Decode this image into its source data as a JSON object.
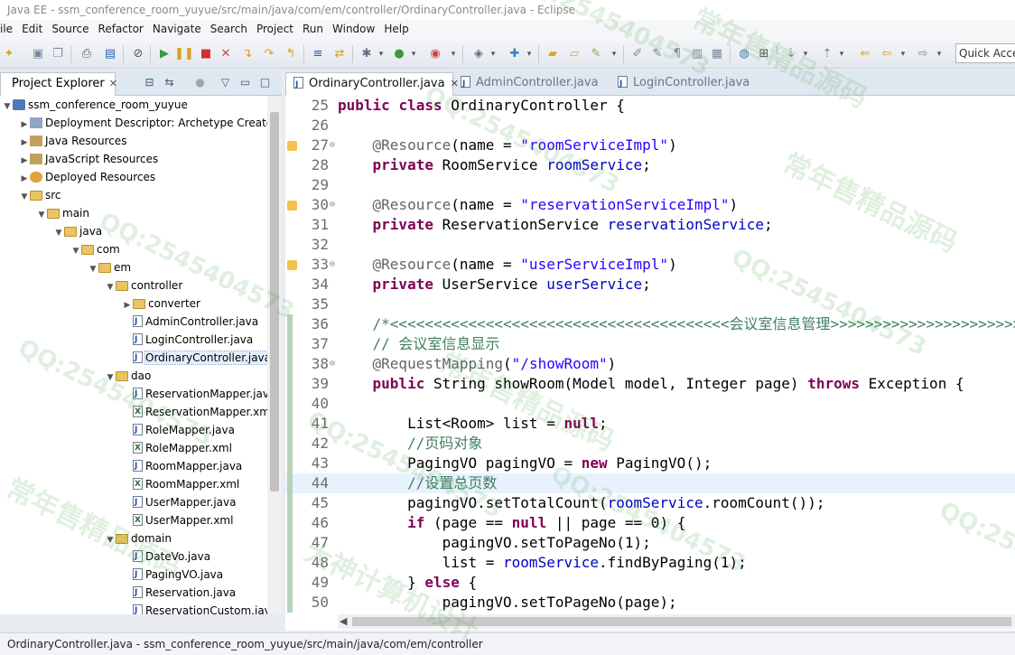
{
  "window_title": "Java EE - ssm_conference_room_yuyue/src/main/java/com/em/controller/OrdinaryController.java - Eclipse",
  "menu": [
    "ile",
    "Edit",
    "Source",
    "Refactor",
    "Navigate",
    "Search",
    "Project",
    "Run",
    "Window",
    "Help"
  ],
  "quick_access_placeholder": "Quick Access",
  "explorer": {
    "tab_label": "Project Explorer",
    "tree": [
      {
        "label": "ssm_conference_room_yuyue",
        "icon": "project-icon",
        "depth": 0,
        "expanded": true
      },
      {
        "label": "Deployment Descriptor: Archetype Created",
        "icon": "deployment-descriptor-icon",
        "depth": 1,
        "expanded": false
      },
      {
        "label": "Java Resources",
        "icon": "java-resources-icon",
        "depth": 1,
        "expanded": false
      },
      {
        "label": "JavaScript Resources",
        "icon": "javascript-resources-icon",
        "depth": 1,
        "expanded": false
      },
      {
        "label": "Deployed Resources",
        "icon": "deployed-resources-icon",
        "depth": 1,
        "expanded": false
      },
      {
        "label": "src",
        "icon": "folder-icon",
        "depth": 1,
        "expanded": true
      },
      {
        "label": "main",
        "icon": "folder-icon",
        "depth": 2,
        "expanded": true
      },
      {
        "label": "java",
        "icon": "folder-icon",
        "depth": 3,
        "expanded": true
      },
      {
        "label": "com",
        "icon": "folder-icon",
        "depth": 4,
        "expanded": true
      },
      {
        "label": "em",
        "icon": "folder-icon",
        "depth": 5,
        "expanded": true
      },
      {
        "label": "controller",
        "icon": "folder-icon",
        "depth": 6,
        "expanded": true
      },
      {
        "label": "converter",
        "icon": "folder-icon",
        "depth": 7,
        "expanded": false
      },
      {
        "label": "AdminController.java",
        "icon": "java-file-icon",
        "depth": 7
      },
      {
        "label": "LoginController.java",
        "icon": "java-file-icon",
        "depth": 7
      },
      {
        "label": "OrdinaryController.java",
        "icon": "java-file-icon",
        "depth": 7,
        "selected": true
      },
      {
        "label": "dao",
        "icon": "folder-icon",
        "depth": 6,
        "expanded": true
      },
      {
        "label": "ReservationMapper.java",
        "icon": "java-file-icon",
        "depth": 7
      },
      {
        "label": "ReservationMapper.xml",
        "icon": "xml-file-icon",
        "depth": 7
      },
      {
        "label": "RoleMapper.java",
        "icon": "java-file-icon",
        "depth": 7
      },
      {
        "label": "RoleMapper.xml",
        "icon": "xml-file-icon",
        "depth": 7
      },
      {
        "label": "RoomMapper.java",
        "icon": "java-file-icon",
        "depth": 7
      },
      {
        "label": "RoomMapper.xml",
        "icon": "xml-file-icon",
        "depth": 7
      },
      {
        "label": "UserMapper.java",
        "icon": "java-file-icon",
        "depth": 7
      },
      {
        "label": "UserMapper.xml",
        "icon": "xml-file-icon",
        "depth": 7
      },
      {
        "label": "domain",
        "icon": "folder-icon",
        "depth": 6,
        "expanded": true
      },
      {
        "label": "DateVo.java",
        "icon": "java-file-icon",
        "depth": 7
      },
      {
        "label": "PagingVO.java",
        "icon": "java-file-icon",
        "depth": 7
      },
      {
        "label": "Reservation.java",
        "icon": "java-file-icon",
        "depth": 7
      },
      {
        "label": "ReservationCustom.java",
        "icon": "java-file-icon",
        "depth": 7
      }
    ]
  },
  "editor": {
    "tabs": [
      {
        "label": "OrdinaryController.java",
        "active": true
      },
      {
        "label": "AdminController.java",
        "active": false
      },
      {
        "label": "LoginController.java",
        "active": false
      }
    ],
    "lines": [
      {
        "n": "25",
        "tokens": [
          [
            "kw",
            "public "
          ],
          [
            "kw",
            "class "
          ],
          [
            "",
            "OrdinaryController {"
          ]
        ]
      },
      {
        "n": "26",
        "tokens": []
      },
      {
        "n": "27",
        "marker": true,
        "fold": true,
        "tokens": [
          [
            "",
            "    "
          ],
          [
            "ann",
            "@Resource"
          ],
          [
            "",
            "(name = "
          ],
          [
            "str",
            "\"roomServiceImpl\""
          ],
          [
            "",
            ")"
          ]
        ]
      },
      {
        "n": "28",
        "tokens": [
          [
            "",
            "    "
          ],
          [
            "kw",
            "private "
          ],
          [
            "",
            "RoomService "
          ],
          [
            "fld",
            "roomService"
          ],
          [
            "",
            ";"
          ]
        ]
      },
      {
        "n": "29",
        "tokens": []
      },
      {
        "n": "30",
        "marker": true,
        "fold": true,
        "tokens": [
          [
            "",
            "    "
          ],
          [
            "ann",
            "@Resource"
          ],
          [
            "",
            "(name = "
          ],
          [
            "str",
            "\"reservationServiceImpl\""
          ],
          [
            "",
            ")"
          ]
        ]
      },
      {
        "n": "31",
        "tokens": [
          [
            "",
            "    "
          ],
          [
            "kw",
            "private "
          ],
          [
            "",
            "ReservationService "
          ],
          [
            "fld",
            "reservationService"
          ],
          [
            "",
            ";"
          ]
        ]
      },
      {
        "n": "32",
        "tokens": []
      },
      {
        "n": "33",
        "marker": true,
        "fold": true,
        "tokens": [
          [
            "",
            "    "
          ],
          [
            "ann",
            "@Resource"
          ],
          [
            "",
            "(name = "
          ],
          [
            "str",
            "\"userServiceImpl\""
          ],
          [
            "",
            ")"
          ]
        ]
      },
      {
        "n": "34",
        "tokens": [
          [
            "",
            "    "
          ],
          [
            "kw",
            "private "
          ],
          [
            "",
            "UserService "
          ],
          [
            "fld",
            "userService"
          ],
          [
            "",
            ";"
          ]
        ]
      },
      {
        "n": "35",
        "tokens": []
      },
      {
        "n": "36",
        "tokens": [
          [
            "",
            "    "
          ],
          [
            "cmt",
            "/*<<<<<<<<<<<<<<<<<<<<<<<<<<<<<<<<<<<<<<<会议室信息管理>>>>>>>>>>>>>>>>>>>>>>>>>>"
          ]
        ]
      },
      {
        "n": "37",
        "tokens": [
          [
            "",
            "    "
          ],
          [
            "cmt",
            "// 会议室信息显示"
          ]
        ]
      },
      {
        "n": "38",
        "fold": true,
        "tokens": [
          [
            "",
            "    "
          ],
          [
            "ann",
            "@RequestMapping"
          ],
          [
            "",
            "("
          ],
          [
            "str",
            "\"/showRoom\""
          ],
          [
            "",
            ")"
          ]
        ]
      },
      {
        "n": "39",
        "tokens": [
          [
            "",
            "    "
          ],
          [
            "kw",
            "public "
          ],
          [
            "",
            "String showRoom(Model model, Integer page) "
          ],
          [
            "kw",
            "throws "
          ],
          [
            "",
            "Exception {"
          ]
        ]
      },
      {
        "n": "40",
        "tokens": []
      },
      {
        "n": "41",
        "tokens": [
          [
            "",
            "        List<Room> list = "
          ],
          [
            "kw",
            "null"
          ],
          [
            "",
            ";"
          ]
        ]
      },
      {
        "n": "42",
        "tokens": [
          [
            "",
            "        "
          ],
          [
            "cmt",
            "//页码对象"
          ]
        ]
      },
      {
        "n": "43",
        "tokens": [
          [
            "",
            "        PagingVO pagingVO = "
          ],
          [
            "kw",
            "new "
          ],
          [
            "",
            "PagingVO();"
          ]
        ]
      },
      {
        "n": "44",
        "highlight": true,
        "tokens": [
          [
            "",
            "        "
          ],
          [
            "cmt",
            "//设置总页数"
          ]
        ]
      },
      {
        "n": "45",
        "tokens": [
          [
            "",
            "        pagingVO.setTotalCount("
          ],
          [
            "fld",
            "roomService"
          ],
          [
            "",
            ".roomCount());"
          ]
        ]
      },
      {
        "n": "46",
        "tokens": [
          [
            "",
            "        "
          ],
          [
            "kw",
            "if "
          ],
          [
            "",
            "(page == "
          ],
          [
            "kw",
            "null "
          ],
          [
            "",
            "|| page == 0) {"
          ]
        ]
      },
      {
        "n": "47",
        "tokens": [
          [
            "",
            "            pagingVO.setToPageNo(1);"
          ]
        ]
      },
      {
        "n": "48",
        "tokens": [
          [
            "",
            "            list = "
          ],
          [
            "fld",
            "roomService"
          ],
          [
            "",
            ".findByPaging(1);"
          ]
        ]
      },
      {
        "n": "49",
        "tokens": [
          [
            "",
            "        } "
          ],
          [
            "kw",
            "else "
          ],
          [
            "",
            "{"
          ]
        ]
      },
      {
        "n": "50",
        "tokens": [
          [
            "",
            "            pagingVO.setToPageNo(page);"
          ]
        ]
      }
    ]
  },
  "status_text": "OrdinaryController.java - ssm_conference_room_yuyue/src/main/java/com/em/controller",
  "watermarks": [
    "QQ:2545404573",
    "常年售精品源码",
    "大神计算机设计"
  ],
  "colors": {
    "keyword": "#7f0055",
    "string": "#2a00ff",
    "field": "#0000c0",
    "comment": "#3f7f5f",
    "annotation": "#646464",
    "watermark": "#3ca03c"
  }
}
